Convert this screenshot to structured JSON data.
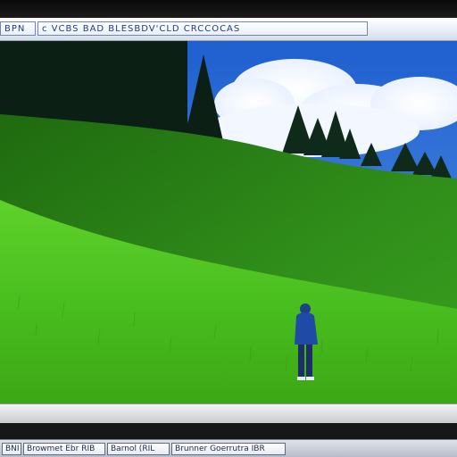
{
  "window": {
    "title_parts": [
      "BPN",
      "ᴄ VCBS BAD BLESBDV'CLD CRCCOCAS"
    ]
  },
  "taskbar": {
    "items": [
      "BNI",
      "Browmet Ebr RIB",
      "Barnol (RIL",
      "Brunner Goerrutra IBR"
    ]
  },
  "scene": {
    "description_icon": "wallpaper-landscape",
    "sky_color": "#2c6fd6",
    "grass_color": "#3cb41a"
  }
}
